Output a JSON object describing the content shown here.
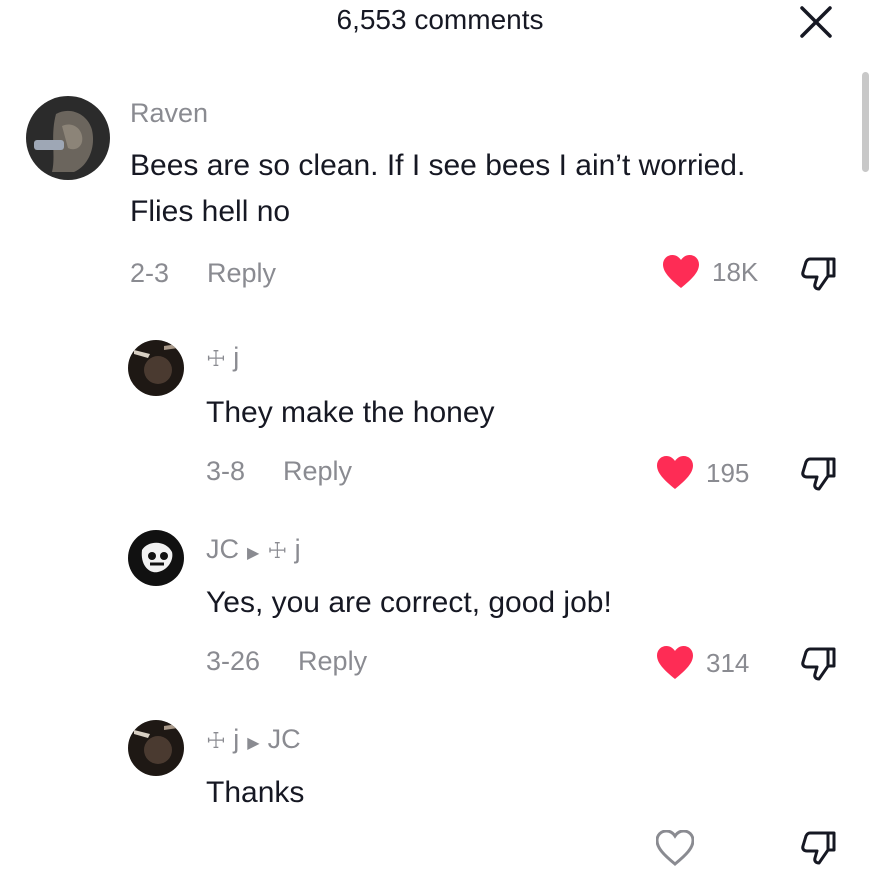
{
  "header": {
    "title": "6,553 comments"
  },
  "comments": [
    {
      "username": "Raven",
      "text": "Bees are so clean. If I see bees I ain’t worried. Flies hell no",
      "date": "2-3",
      "reply_label": "Reply",
      "likes": "18K"
    },
    {
      "username": "j",
      "text": "They make the honey",
      "date": "3-8",
      "reply_label": "Reply",
      "likes": "195"
    },
    {
      "username": "JC",
      "reply_to": "j",
      "text": "Yes, you are correct, good job!",
      "date": "3-26",
      "reply_label": "Reply",
      "likes": "314"
    },
    {
      "username": "j",
      "reply_to": "JC",
      "text": "Thanks"
    }
  ],
  "colors": {
    "heart": "#fe2c55",
    "muted": "#8a8b91",
    "text": "#161823"
  },
  "icons": [
    "close-icon",
    "heart-icon",
    "dislike-icon",
    "cross-icon"
  ]
}
